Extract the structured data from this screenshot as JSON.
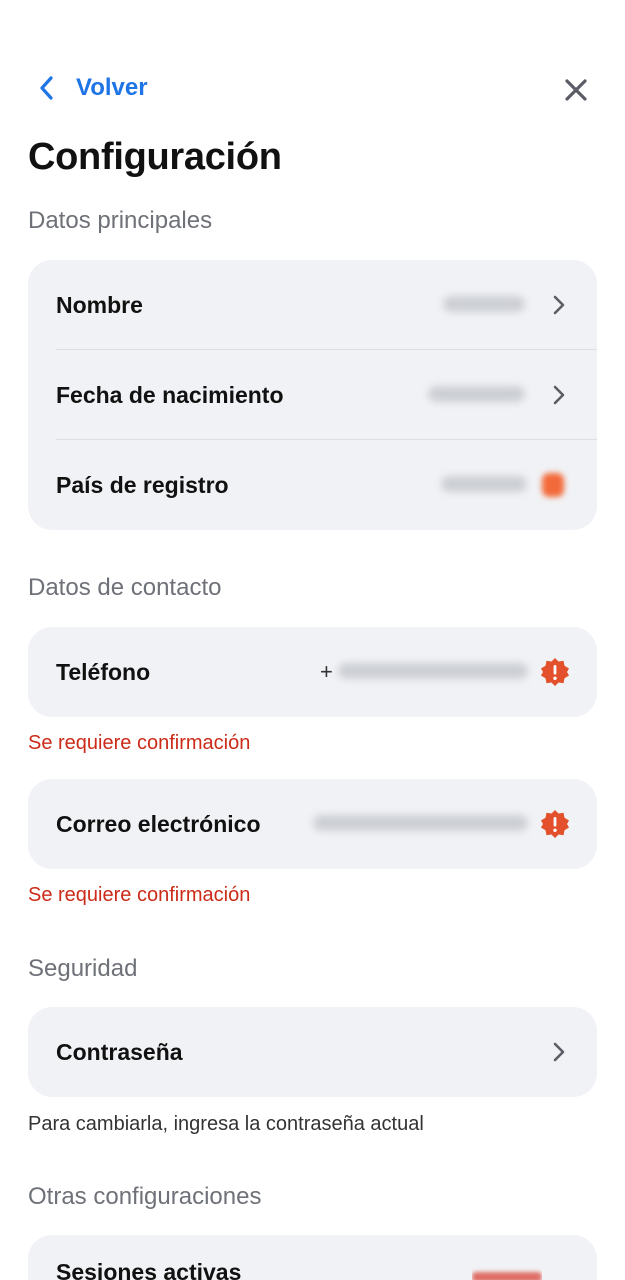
{
  "header": {
    "back_label": "Volver",
    "page_title": "Configuración"
  },
  "sections": {
    "main": "Datos principales",
    "contact": "Datos de contacto",
    "security": "Seguridad",
    "other": "Otras configuraciones"
  },
  "main_rows": {
    "name": "Nombre",
    "birthdate": "Fecha de nacimiento",
    "country": "País de registro"
  },
  "contact_rows": {
    "phone": "Teléfono",
    "phone_prefix": "+",
    "email": "Correo electrónico",
    "confirmation_required": "Se requiere confirmación"
  },
  "security_rows": {
    "password": "Contraseña",
    "password_hint": "Para cambiarla, ingresa la contraseña actual"
  },
  "other_rows": {
    "active_sessions": "Sesiones activas"
  },
  "colors": {
    "accent": "#1f74e6",
    "warning": "#e2512c",
    "error_text": "#cc2b18",
    "card_bg": "#f1f2f5"
  }
}
